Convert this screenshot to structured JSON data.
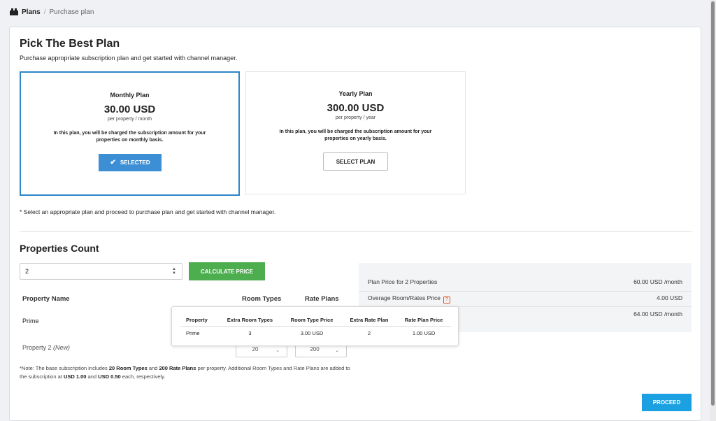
{
  "breadcrumb": {
    "root": "Plans",
    "separator": "/",
    "current": "Purchase plan"
  },
  "header": {
    "title": "Pick The Best Plan",
    "subtitle": "Purchase appropriate subscription plan and get started with channel manager."
  },
  "plans": [
    {
      "name": "Monthly Plan",
      "price": "30.00 USD",
      "period": "per property / month",
      "description": "In this plan, you will be charged the subscription amount for your properties on monthly basis.",
      "button_label": "SELECTED",
      "selected": true
    },
    {
      "name": "Yearly Plan",
      "price": "300.00 USD",
      "period": "per property / year",
      "description": "In this plan, you will be charged the subscription amount for your properties on yearly basis.",
      "button_label": "SELECT PLAN",
      "selected": false
    }
  ],
  "plan_note": "* Select an appropriate plan and proceed to purchase plan and get started with channel manager.",
  "properties": {
    "title": "Properties Count",
    "count_value": "2",
    "calculate_label": "CALCULATE PRICE",
    "columns": [
      "Property Name",
      "Room Types",
      "Rate Plans"
    ],
    "rows": [
      {
        "name": "Prime",
        "room_types": "",
        "rate_plans": ""
      },
      {
        "name": "Property 2",
        "tag": "(New)",
        "room_types": "20",
        "rate_plans": "200"
      }
    ],
    "note_parts": {
      "p1": "*Note: The base subscription includes ",
      "b1": "20 Room Types",
      "p2": " and ",
      "b2": "200 Rate Plans",
      "p3": " per property. Additional Room Types and Rate Plans are added to the subscription at ",
      "b3": "USD 1.00",
      "p4": " and ",
      "b4": "USD 0.50",
      "p5": " each, respectively."
    }
  },
  "summary": {
    "rows": [
      {
        "label": "Plan Price for 2 Properties",
        "value": "60.00 USD  /month"
      },
      {
        "label": "Overage Room/Rates Price",
        "value": "4.00 USD"
      },
      {
        "label": "",
        "value": "64.00 USD  /month"
      }
    ]
  },
  "tooltip": {
    "headers": [
      "Property",
      "Extra Room Types",
      "Room Type Price",
      "Extra Rate Plan",
      "Rate Plan Price"
    ],
    "rows": [
      [
        "Prime",
        "3",
        "3.00 USD",
        "2",
        "1.00 USD"
      ]
    ]
  },
  "proceed_label": "PROCEED",
  "colors": {
    "selected_blue": "#3d8fd5",
    "calculate_green": "#4cae4f",
    "proceed_blue": "#1ba1e2",
    "info_icon": "#e0502a"
  },
  "icons": {
    "breadcrumb": "home-icon",
    "selected": "check-icon",
    "spinner": "spinner-arrows-icon",
    "dropdown": "chevron-down-icon",
    "overage": "info-icon"
  }
}
